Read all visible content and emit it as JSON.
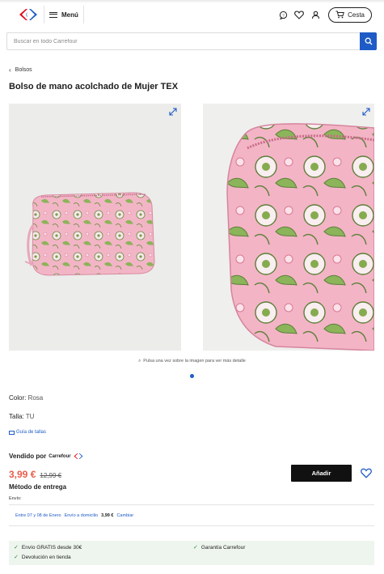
{
  "header": {
    "menu_label": "Menú",
    "cart_label": "Cesta"
  },
  "search": {
    "placeholder": "Buscar en todo Carrefour"
  },
  "breadcrumb": {
    "label": "Bolsos"
  },
  "product": {
    "title": "Bolso de mano acolchado de Mujer TEX",
    "image_hint": "Pulsa una vez sobre la imagen para ver más detalle",
    "color_label": "Color:",
    "color_value": "Rosa",
    "size_label": "Talla:",
    "size_value": "TU",
    "size_guide": "Guía de tallas"
  },
  "purchase": {
    "sold_by": "Vendido por",
    "seller_name": "Carrefour",
    "price": "3,99 €",
    "old_price": "12,99 €",
    "add_label": "Añadir",
    "delivery_title": "Método de entrega",
    "envio_label": "Envío:",
    "delivery_date": "Entre 07 y 08 de Enero",
    "delivery_mode": "Envío a domicilio",
    "delivery_cost": "3,99 €",
    "change_label": "Cambiar"
  },
  "benefits": {
    "free_shipping": "Envío GRATIS desde 30€",
    "returns": "Devolución en tienda",
    "guarantee": "Garantía Carrefour"
  },
  "colors": {
    "accent_blue": "#1e5bc6",
    "price_red": "#e85d4a",
    "brand_red": "#e30613"
  }
}
